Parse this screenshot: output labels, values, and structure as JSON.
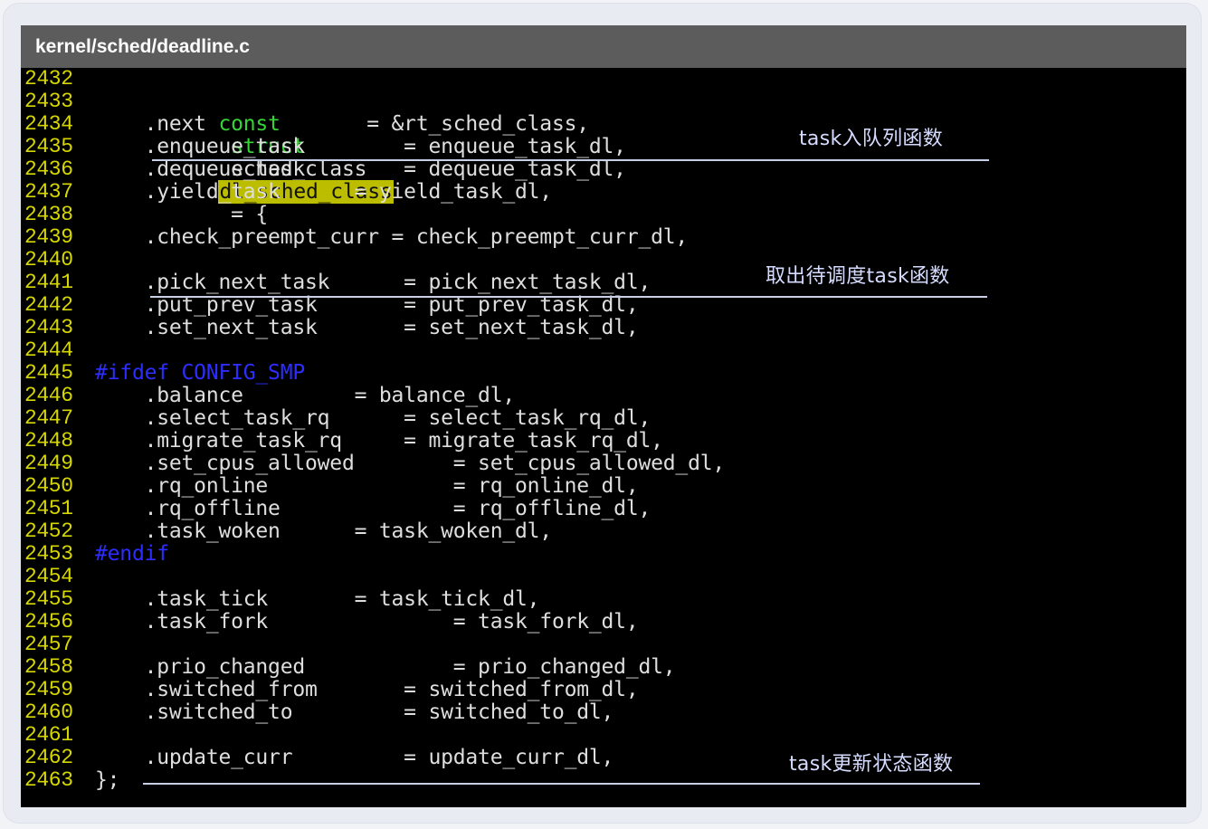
{
  "file_path": "kernel/sched/deadline.c",
  "code": {
    "lines": [
      {
        "n": "2432",
        "t": ""
      },
      {
        "n": "2433",
        "t": "const struct sched_class dl_sched_class = {"
      },
      {
        "n": "2434",
        "t": "    .next             = &rt_sched_class,"
      },
      {
        "n": "2435",
        "t": "    .enqueue_task        = enqueue_task_dl,"
      },
      {
        "n": "2436",
        "t": "    .dequeue_task        = dequeue_task_dl,"
      },
      {
        "n": "2437",
        "t": "    .yield_task      = yield_task_dl,"
      },
      {
        "n": "2438",
        "t": ""
      },
      {
        "n": "2439",
        "t": "    .check_preempt_curr = check_preempt_curr_dl,"
      },
      {
        "n": "2440",
        "t": ""
      },
      {
        "n": "2441",
        "t": "    .pick_next_task      = pick_next_task_dl,"
      },
      {
        "n": "2442",
        "t": "    .put_prev_task       = put_prev_task_dl,"
      },
      {
        "n": "2443",
        "t": "    .set_next_task       = set_next_task_dl,"
      },
      {
        "n": "2444",
        "t": ""
      },
      {
        "n": "2445",
        "t": "#ifdef CONFIG_SMP"
      },
      {
        "n": "2446",
        "t": "    .balance         = balance_dl,"
      },
      {
        "n": "2447",
        "t": "    .select_task_rq      = select_task_rq_dl,"
      },
      {
        "n": "2448",
        "t": "    .migrate_task_rq     = migrate_task_rq_dl,"
      },
      {
        "n": "2449",
        "t": "    .set_cpus_allowed        = set_cpus_allowed_dl,"
      },
      {
        "n": "2450",
        "t": "    .rq_online               = rq_online_dl,"
      },
      {
        "n": "2451",
        "t": "    .rq_offline              = rq_offline_dl,"
      },
      {
        "n": "2452",
        "t": "    .task_woken      = task_woken_dl,"
      },
      {
        "n": "2453",
        "t": "#endif"
      },
      {
        "n": "2454",
        "t": ""
      },
      {
        "n": "2455",
        "t": "    .task_tick       = task_tick_dl,"
      },
      {
        "n": "2456",
        "t": "    .task_fork               = task_fork_dl,"
      },
      {
        "n": "2457",
        "t": ""
      },
      {
        "n": "2458",
        "t": "    .prio_changed            = prio_changed_dl,"
      },
      {
        "n": "2459",
        "t": "    .switched_from       = switched_from_dl,"
      },
      {
        "n": "2460",
        "t": "    .switched_to         = switched_to_dl,"
      },
      {
        "n": "2461",
        "t": ""
      },
      {
        "n": "2462",
        "t": "    .update_curr         = update_curr_dl,"
      },
      {
        "n": "2463",
        "t": "};"
      }
    ]
  },
  "annotations": {
    "enqueue": "task入队列函数",
    "pick": "取出待调度task函数",
    "update": "task更新状态函数"
  },
  "colors": {
    "line_number": "#d7d700",
    "keyword": "#34d534",
    "preprocessor": "#2d2dff",
    "highlight": "#bdbd00",
    "code_text": "#dedede",
    "annotation": "#d6dcff"
  }
}
